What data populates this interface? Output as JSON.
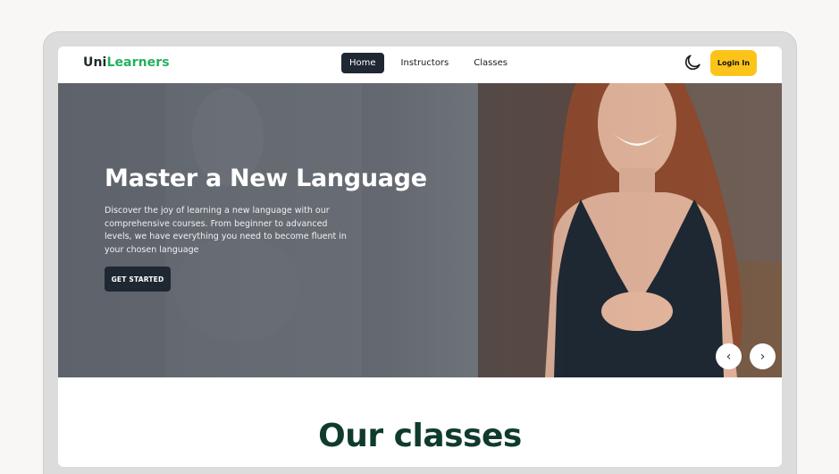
{
  "navbar": {
    "brand_prefix": "Uni",
    "brand_suffix": "Learners",
    "links": [
      {
        "label": "Home",
        "active": true
      },
      {
        "label": "Instructors",
        "active": false
      },
      {
        "label": "Classes",
        "active": false
      }
    ],
    "theme_icon": "moon-icon",
    "login_label": "Login In"
  },
  "hero": {
    "title": "Master a New Language",
    "description": "Discover the joy of learning a new language with our comprehensive courses. From beginner to advanced levels, we have everything you need to become fluent in your chosen language",
    "cta_label": "GET STARTED",
    "prev_icon": "‹",
    "next_icon": "›"
  },
  "section": {
    "title": "Our classes"
  },
  "colors": {
    "brand_green": "#22b15f",
    "accent_yellow": "#fcc419",
    "dark_button": "#1f2733",
    "section_title": "#0f3b2e"
  }
}
